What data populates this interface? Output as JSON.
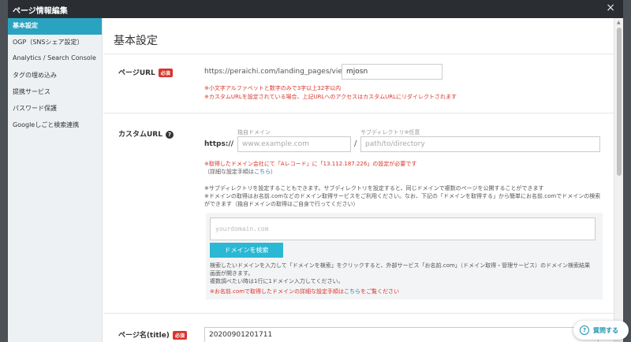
{
  "window": {
    "title": "ページ情報編集",
    "close_glyph": "×"
  },
  "sidebar": {
    "items": [
      {
        "label": "基本設定",
        "active": true
      },
      {
        "label": "OGP（SNSシェア設定）"
      },
      {
        "label": "Analytics / Search Console"
      },
      {
        "label": "タグの埋め込み"
      },
      {
        "label": "提携サービス"
      },
      {
        "label": "パスワード保護"
      },
      {
        "label": "Googleしごと検索連携"
      }
    ]
  },
  "main": {
    "heading": "基本設定",
    "page_url": {
      "label": "ページURL",
      "badge": "必須",
      "prefix": "https://peraichi.com/landing_pages/view/",
      "value": "mjosn",
      "notes": [
        "※小文字アルファベットと数字のみで3字以上32字以内",
        "※カスタムURLを設定されている場合、上記URLへのアクセスはカスタムURLにリダイレクトされます"
      ]
    },
    "custom_url": {
      "label": "カスタムURL",
      "help_glyph": "?",
      "https": "https://",
      "domain_label": "独自ドメイン",
      "domain_placeholder": "www.example.com",
      "slash": "/",
      "subdir_label": "サブディレクトリ※任意",
      "subdir_placeholder": "path/to/directory",
      "a_record_note": "※取得したドメイン会社にて「Aレコード」に「13.112.187.226」の設定が必要です",
      "detail_prefix": "（詳細な設定手順は",
      "detail_link": "こちら",
      "detail_suffix": "）",
      "info_lines": [
        "※サブディレクトリを設定することもできます。サブディレクトリを設定すると、同じドメインで複数のページを公開することができます",
        "※ドメインの取得はお名前.comなどのドメイン取得サービスをご利用ください。なお、下記の「ドメインを取得する」から簡単にお名前.comでドメインの検索",
        "ができます（独自ドメインの取得はご自身で行ってください）"
      ],
      "search": {
        "placeholder": "yourdomain.com",
        "button": "ドメインを検索",
        "desc_lines": [
          "検索したいドメインを入力して「ドメインを検索」をクリックすると、外部サービス「お名前.com」（ドメイン取得・管理サービス）のドメイン検索結果",
          "画面が開きます。",
          "複数調べたい時は1行に1ドメイン入力してください。"
        ],
        "onamae_prefix": "※お名前.comで取得したドメインの詳細な設定手順は",
        "onamae_link": "こちら",
        "onamae_suffix": "をご覧ください"
      }
    },
    "page_title": {
      "label": "ページ名(title)",
      "badge": "必須",
      "value": "20200901201711"
    }
  },
  "help_button": {
    "label": "質問する",
    "glyph": "?"
  },
  "colors": {
    "accent": "#2aa3c0",
    "required_badge": "#d9342b",
    "titlebar": "#2a2e33",
    "search_button": "#2ab8d4"
  }
}
